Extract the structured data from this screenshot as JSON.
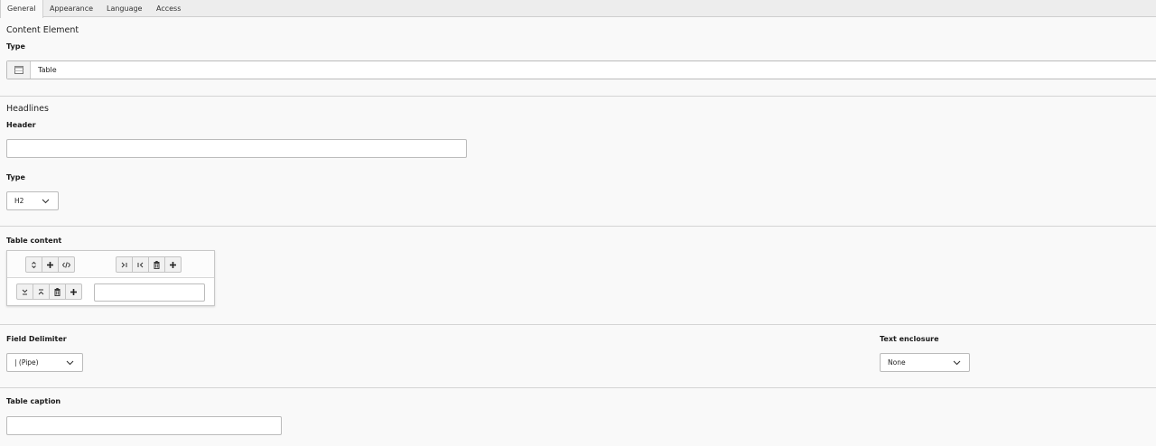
{
  "tabs": [
    {
      "label": "General",
      "active": true
    },
    {
      "label": "Appearance",
      "active": false
    },
    {
      "label": "Language",
      "active": false
    },
    {
      "label": "Access",
      "active": false
    }
  ],
  "content_element": {
    "section_title": "Content Element",
    "type_label": "Type",
    "type_value": "Table",
    "type_icon": "table-icon"
  },
  "headlines": {
    "section_title": "Headlines",
    "header_label": "Header",
    "header_value": "",
    "type_label": "Type",
    "type_value": "H2"
  },
  "table_content": {
    "label": "Table content",
    "column_buttons": [
      "move-column-icon",
      "add-column-icon",
      "code-toggle-icon"
    ],
    "row_end_buttons": [
      "move-to-end-icon",
      "move-to-start-icon",
      "delete-column-icon",
      "add-column-end-icon"
    ],
    "row_buttons": [
      "move-down-icon",
      "move-up-icon",
      "delete-row-icon",
      "add-row-icon"
    ],
    "cell_value": ""
  },
  "field_delimiter": {
    "label": "Field Delimiter",
    "value": "| (Pipe)"
  },
  "text_enclosure": {
    "label": "Text enclosure",
    "value": "None"
  },
  "table_caption": {
    "label": "Table caption",
    "value": ""
  }
}
